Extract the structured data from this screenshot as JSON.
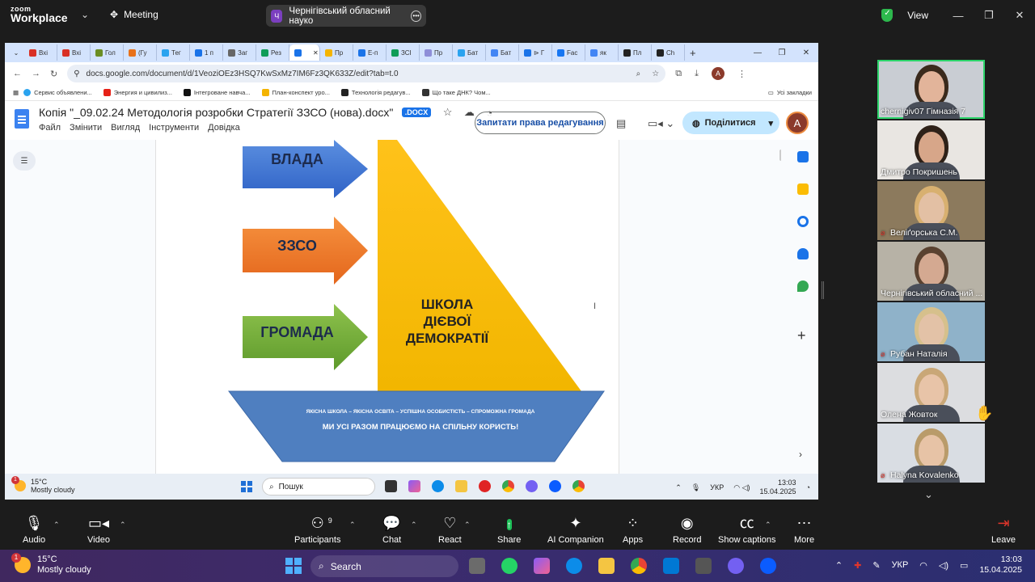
{
  "zoom": {
    "logo_top": "zoom",
    "logo_bottom": "Workplace",
    "meeting_label": "Meeting",
    "meeting_pill_initial": "Ч",
    "meeting_pill_title": "Чернігівський обласний науко",
    "view_label": "View"
  },
  "browser": {
    "tabs": [
      {
        "label": "Вхі",
        "color": "#d93025"
      },
      {
        "label": "Вхі",
        "color": "#d93025"
      },
      {
        "label": "Гол",
        "color": "#6b8e23"
      },
      {
        "label": "(Гу",
        "color": "#e8711a"
      },
      {
        "label": "Тег",
        "color": "#2aa3ef"
      },
      {
        "label": "1 п",
        "color": "#1a73e8"
      },
      {
        "label": "Заг",
        "color": "#666666"
      },
      {
        "label": "Рез",
        "color": "#0f9d58"
      },
      {
        "label": "",
        "color": "#1a73e8",
        "active": true
      },
      {
        "label": "Пр",
        "color": "#f4b400"
      },
      {
        "label": "E-п",
        "color": "#1a73e8"
      },
      {
        "label": "ЗСІ",
        "color": "#0f9d58"
      },
      {
        "label": "Пр",
        "color": "#8e8ed8"
      },
      {
        "label": "Бат",
        "color": "#2aa3ef"
      },
      {
        "label": "Бат",
        "color": "#4285f4"
      },
      {
        "label": "⊳ Г",
        "color": "#1a73e8"
      },
      {
        "label": "Fac",
        "color": "#1877f2"
      },
      {
        "label": "як",
        "color": "#4285f4"
      },
      {
        "label": "Пл",
        "color": "#222222"
      },
      {
        "label": "Ch",
        "color": "#222222"
      }
    ],
    "url": "docs.google.com/document/d/1VeoziOEz3HSQ7KwSxMz7IM6Fz3QK633Z/edit?tab=t.0",
    "bookmarks": [
      "Сервис объявлени...",
      "Энергия и цивилиз...",
      "Інтегроване навча...",
      "План-конспект уро...",
      "Технологія редагув...",
      "Що таке ДНК? Чом..."
    ],
    "bookmarks_all": "Усі закладки",
    "doc_title": "Копія \"_09.02.24 Методологія розробки Стратегії ЗЗСО (нова).docx\"",
    "doc_badge": ".DOCX",
    "menu": [
      "Файл",
      "Змінити",
      "Вигляд",
      "Інструменти",
      "Довідка"
    ],
    "request_edit": "Запитати права редагування",
    "share": "Поділитися",
    "avatar": "A"
  },
  "slide": {
    "arrow1": "ВЛАДА",
    "arrow2": "ЗЗСО",
    "arrow3": "ГРОМАДА",
    "sail_line1": "ШКОЛА",
    "sail_line2": "ДІЄВОЇ",
    "sail_line3": "ДЕМОКРАТІЇ",
    "boat_small": "ЯКІСНА ШКОЛА – ЯКІСНА ОСВІТА – УСПІШНА ОСОБИСТІСТЬ – СПРОМОЖНА ГРОМАДА",
    "boat_main": "МИ УСІ РАЗОМ ПРАЦЮЄМО НА СПІЛЬНУ КОРИСТЬ!"
  },
  "inner_taskbar": {
    "temp": "15°C",
    "weather": "Mostly cloudy",
    "search": "Пошук",
    "lang": "УКР",
    "time": "13:03",
    "date": "15.04.2025",
    "badge": "1"
  },
  "participants": [
    {
      "name": "chernigiv07 Гімназія 7",
      "muted": false,
      "bg": "#c9cdd3",
      "face": "#e2b49a",
      "hair": "#3a2a1c",
      "active": true
    },
    {
      "name": "Дмитро Покришень",
      "muted": false,
      "bg": "#e9e6e2",
      "face": "#d7a689",
      "hair": "#2e2118"
    },
    {
      "name": "Веліґорська С.М.",
      "muted": true,
      "bg": "#8c7a5d",
      "face": "#e3c0a4",
      "hair": "#d8b070"
    },
    {
      "name": "Чернігівський обласний ...",
      "muted": false,
      "bg": "#b7b2a6",
      "face": "#d4a991",
      "hair": "#5a4230"
    },
    {
      "name": "Рубан Наталія",
      "muted": true,
      "bg": "#8fb2c9",
      "face": "#e3c2a7",
      "hair": "#d6c08c"
    },
    {
      "name": "Олена Жовток",
      "muted": false,
      "bg": "#dcdde0",
      "face": "#e8c4a8",
      "hair": "#c9a777"
    },
    {
      "name": "Halyna Kovalenko",
      "muted": true,
      "bg": "#d9dde3",
      "face": "#e7c3a6",
      "hair": "#b99b6a"
    }
  ],
  "controls": {
    "audio": "Audio",
    "video": "Video",
    "participants": "Participants",
    "participants_count": "9",
    "chat": "Chat",
    "react": "React",
    "share": "Share",
    "ai": "AI Companion",
    "apps": "Apps",
    "record": "Record",
    "captions": "Show captions",
    "more": "More",
    "leave": "Leave"
  },
  "system_taskbar": {
    "temp": "15°C",
    "weather": "Mostly cloudy",
    "search": "Search",
    "lang": "УКР",
    "time": "13:03",
    "date": "15.04.2025",
    "badge": "1"
  }
}
